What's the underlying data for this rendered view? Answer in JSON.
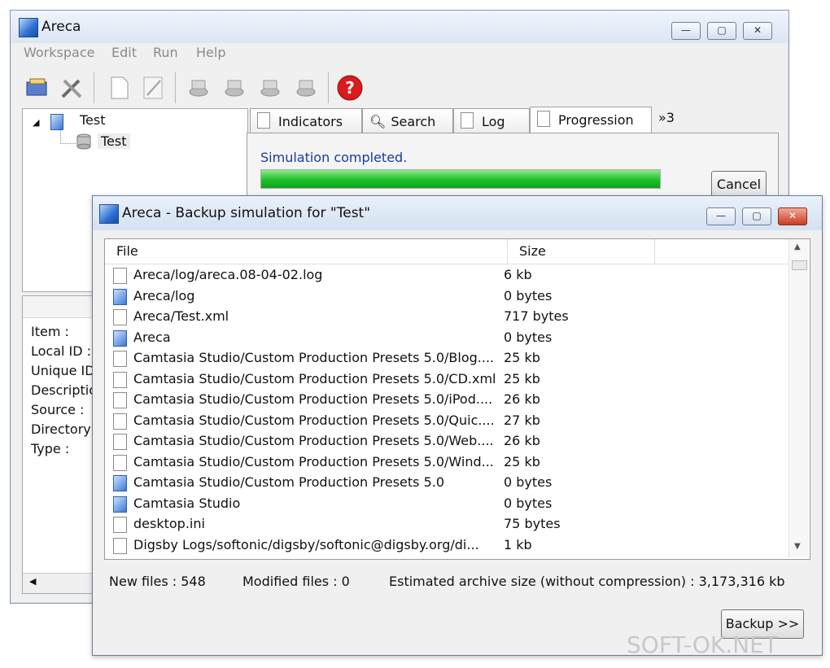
{
  "main_window": {
    "title": "Areca",
    "menu": [
      "Workspace",
      "Edit",
      "Run",
      "Help"
    ],
    "tree": {
      "root": "Test",
      "child": "Test"
    },
    "properties": [
      "Item :",
      "Local ID :",
      "Unique ID",
      "Descriptio",
      "Source :",
      "Directory",
      "Type :"
    ],
    "tabs": [
      "Indicators",
      "Search",
      "Log",
      "Progression"
    ],
    "tabs_overflow": "»3",
    "status": "Simulation completed.",
    "progress": 1.0,
    "cancel_label": "Cancel"
  },
  "dialog": {
    "title": "Areca - Backup simulation for \"Test\"",
    "columns": [
      "File",
      "Size"
    ],
    "rows": [
      {
        "name": "Areca/log/areca.08-04-02.log",
        "size": "6 kb",
        "icon": "file-icon"
      },
      {
        "name": "Areca/log",
        "size": "0 bytes",
        "icon": "folder-icon"
      },
      {
        "name": "Areca/Test.xml",
        "size": "717 bytes",
        "icon": "file-icon"
      },
      {
        "name": "Areca",
        "size": "0 bytes",
        "icon": "folder-icon"
      },
      {
        "name": "Camtasia Studio/Custom Production Presets 5.0/Blog....",
        "size": "25 kb",
        "icon": "file-icon"
      },
      {
        "name": "Camtasia Studio/Custom Production Presets 5.0/CD.xml",
        "size": "25 kb",
        "icon": "file-icon"
      },
      {
        "name": "Camtasia Studio/Custom Production Presets 5.0/iPod....",
        "size": "26 kb",
        "icon": "file-icon"
      },
      {
        "name": "Camtasia Studio/Custom Production Presets 5.0/Quic....",
        "size": "27 kb",
        "icon": "file-icon"
      },
      {
        "name": "Camtasia Studio/Custom Production Presets 5.0/Web....",
        "size": "26 kb",
        "icon": "file-icon"
      },
      {
        "name": "Camtasia Studio/Custom Production Presets 5.0/Wind...",
        "size": "25 kb",
        "icon": "file-icon"
      },
      {
        "name": "Camtasia Studio/Custom Production Presets 5.0",
        "size": "0 bytes",
        "icon": "folder-icon"
      },
      {
        "name": "Camtasia Studio",
        "size": "0 bytes",
        "icon": "folder-icon"
      },
      {
        "name": "desktop.ini",
        "size": "75 bytes",
        "icon": "file-icon"
      },
      {
        "name": "Digsby Logs/softonic/digsby/softonic@digsby.org/di...",
        "size": "1 kb",
        "icon": "file-icon"
      }
    ],
    "new_files": "New files :  548",
    "modified_files": "Modified files :  0",
    "archive_size": "Estimated archive size (without compression) :  3,173,316 kb",
    "backup_label": "Backup >>"
  },
  "watermark": "SOFT-OK.NET"
}
